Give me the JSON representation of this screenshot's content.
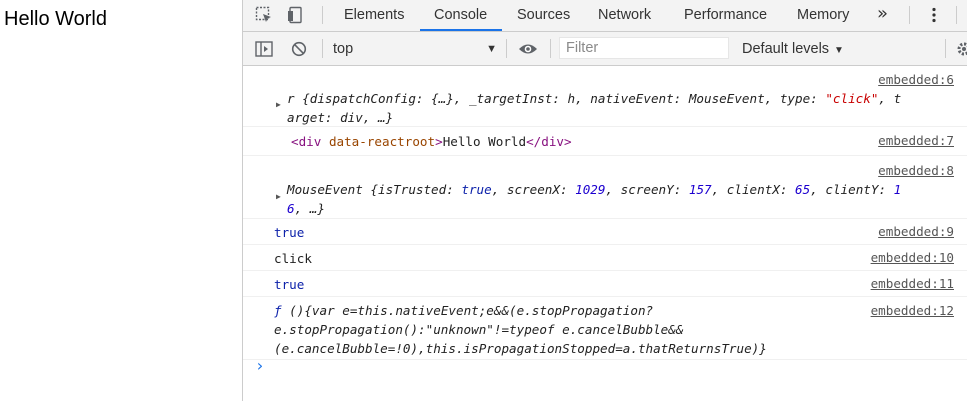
{
  "page": {
    "text": "Hello World"
  },
  "devtools": {
    "tabs": [
      "Elements",
      "Console",
      "Sources",
      "Network",
      "Performance",
      "Memory"
    ],
    "active_tab": "Console",
    "more_tabs": "»",
    "context": "top",
    "filter_placeholder": "Filter",
    "levels": "Default levels"
  },
  "console": {
    "messages": [
      {
        "source": "embedded:6",
        "line1": [
          "r {dispatchConfig: {…}, _targetInst: h, nativeEvent: MouseEvent, type: ",
          "\"click\"",
          ", t"
        ],
        "line2": "arget: div, …}"
      },
      {
        "source": "embedded:7",
        "open_tag": "<div",
        "attr": "data-reactroot",
        "close_bracket": ">",
        "text": "Hello World",
        "end_tag": "</div>"
      },
      {
        "source": "embedded:8",
        "line1": [
          "MouseEvent {isTrusted: ",
          "true",
          ", screenX: ",
          "1029",
          ", screenY: ",
          "157",
          ", clientX: ",
          "65",
          ", clientY: ",
          "1"
        ],
        "line2": [
          "6",
          ", …}"
        ]
      },
      {
        "source": "embedded:9",
        "text": "true"
      },
      {
        "source": "embedded:10",
        "text": "click"
      },
      {
        "source": "embedded:11",
        "text": "true"
      },
      {
        "source": "embedded:12",
        "line1": [
          "ƒ",
          " (){var e=this.nativeEvent;e&&(e.stopPropagation?"
        ],
        "line2": "e.stopPropagation():\"unknown\"!=typeof e.cancelBubble&&",
        "line3": "(e.cancelBubble=!0),this.isPropagationStopped=a.thatReturnsTrue)}"
      }
    ],
    "prompt": "›"
  },
  "colors": {
    "accent": "#1a73e8",
    "string": "#c80000",
    "number": "#1c00cf",
    "keyword": "#0d22aa"
  }
}
